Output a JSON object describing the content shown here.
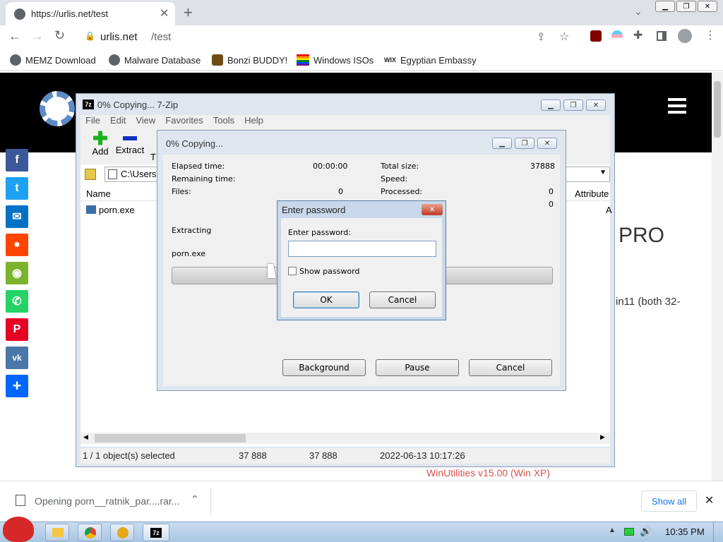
{
  "browser": {
    "tab_title": "https://urlis.net/test",
    "url_host": "urlis.net",
    "url_path": "/test",
    "bookmarks": [
      {
        "label": "MEMZ Download"
      },
      {
        "label": "Malware Database"
      },
      {
        "label": "Bonzi BUDDY!"
      },
      {
        "label": "Windows ISOs"
      },
      {
        "label": "Egyptian Embassy"
      }
    ],
    "wix_badge": "WIX"
  },
  "page": {
    "heading_fragment": "PRO",
    "body_fragment": "in11 (both 32-",
    "footer_link": "WinUtilities v15.00 (Win XP)",
    "footer_color": "#d9534f"
  },
  "sevenzip": {
    "title": "0% Copying... 7-Zip",
    "app_badge": "7z",
    "menu": [
      "File",
      "Edit",
      "View",
      "Favorites",
      "Tools",
      "Help"
    ],
    "toolbar": {
      "add": "Add",
      "extract": "Extract",
      "test": "T"
    },
    "path": "C:\\Users\\",
    "columns": {
      "name": "Name",
      "attributes": "Attribute"
    },
    "file": "porn.exe",
    "attr_fragment": "A",
    "status": {
      "selected": "1 / 1 object(s) selected",
      "size1": "37 888",
      "size2": "37 888",
      "date": "2022-06-13 10:17:26"
    }
  },
  "progress": {
    "title": "0% Copying...",
    "elapsed_label": "Elapsed time:",
    "elapsed_value": "00:00:00",
    "remaining_label": "Remaining time:",
    "files_label": "Files:",
    "files_value": "0",
    "total_label": "Total size:",
    "total_value": "37888",
    "speed_label": "Speed:",
    "processed_label": "Processed:",
    "processed_value": "0",
    "extra_value": "0",
    "extracting_label": "Extracting",
    "current_file": "porn.exe",
    "background_btn": "Background",
    "pause_btn": "Pause",
    "cancel_btn": "Cancel"
  },
  "password": {
    "title": "Enter password",
    "label": "Enter password:",
    "show_label": "Show password",
    "ok": "OK",
    "cancel": "Cancel"
  },
  "download": {
    "filename": "Opening porn__ratnik_par....rar...",
    "show_all": "Show all"
  },
  "taskbar": {
    "clock": "10:35 PM"
  },
  "share_colors": {
    "facebook": "#3b5998",
    "twitter": "#1da1f2",
    "email": "#0072c6",
    "reddit": "#ff4500",
    "wechat": "#7bb32e",
    "whatsapp": "#25d366",
    "pinterest": "#e60023",
    "vk": "#4a76a8",
    "share": "#0166ff"
  }
}
